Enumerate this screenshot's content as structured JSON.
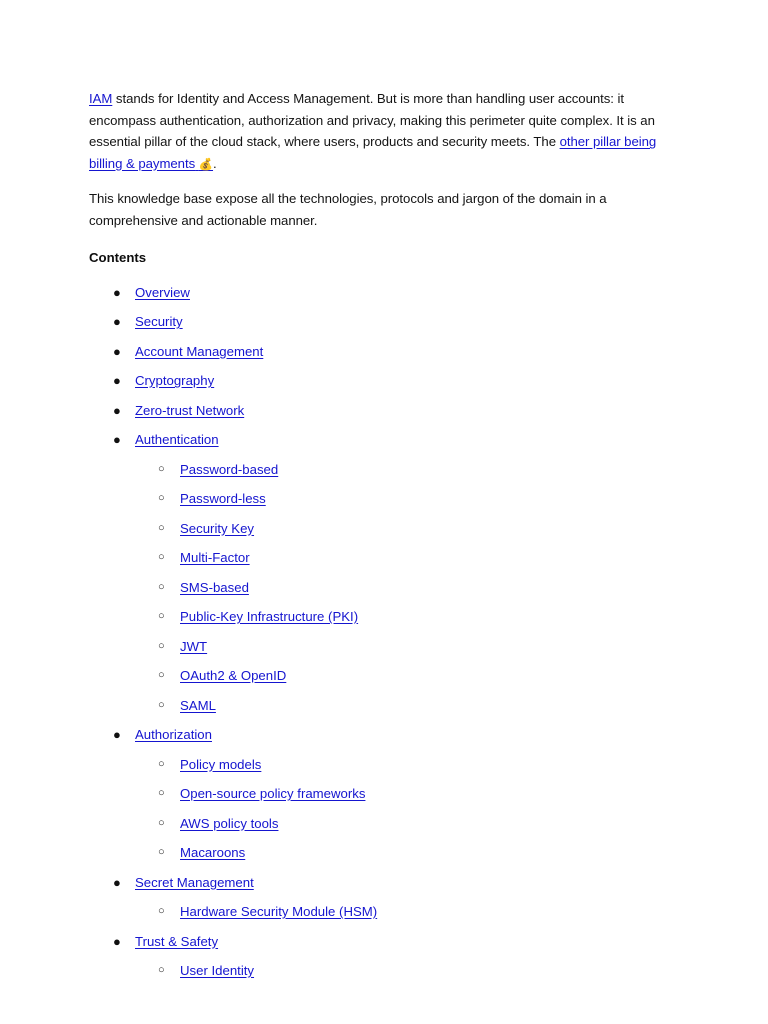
{
  "document": {
    "background_color": "#ffffff",
    "text_color": "#141414",
    "link_color": "#1515cf",
    "intro": {
      "link_label": "IAM",
      "body_part_1": " stands for Identity and Access Management. But is more than handling user accounts: it encompass authentication, authorization and privacy, making this perimeter quite complex. It is an essential pillar of the cloud stack, where users, products and security meets. The ",
      "secondary_link_label": "other pillar being billing & payments",
      "secondary_link_icon": "💰",
      "body_part_2": "."
    },
    "summary": "This knowledge base expose all the technologies, protocols and jargon of the domain in a comprehensive and actionable manner.",
    "contents_heading": "Contents",
    "toc": [
      {
        "label": "Overview",
        "level": 1
      },
      {
        "label": "Security",
        "level": 1
      },
      {
        "label": "Account Management",
        "level": 1
      },
      {
        "label": "Cryptography",
        "level": 1
      },
      {
        "label": "Zero-trust Network",
        "level": 1
      },
      {
        "label": "Authentication",
        "level": 1
      },
      {
        "label": "Password-based",
        "level": 2
      },
      {
        "label": "Password-less",
        "level": 2
      },
      {
        "label": "Security Key",
        "level": 2
      },
      {
        "label": "Multi-Factor",
        "level": 2
      },
      {
        "label": "SMS-based",
        "level": 2
      },
      {
        "label": "Public-Key Infrastructure (PKI)",
        "level": 2
      },
      {
        "label": "JWT",
        "level": 2
      },
      {
        "label": "OAuth2 & OpenID",
        "level": 2
      },
      {
        "label": "SAML",
        "level": 2
      },
      {
        "label": "Authorization",
        "level": 1
      },
      {
        "label": "Policy models",
        "level": 2
      },
      {
        "label": "Open-source policy frameworks",
        "level": 2
      },
      {
        "label": "AWS policy tools",
        "level": 2
      },
      {
        "label": "Macaroons",
        "level": 2
      },
      {
        "label": "Secret Management",
        "level": 1
      },
      {
        "label": "Hardware Security Module (HSM)",
        "level": 2
      },
      {
        "label": "Trust & Safety",
        "level": 1
      },
      {
        "label": "User Identity",
        "level": 2
      }
    ],
    "bullets": {
      "level_1_glyph": "●",
      "level_2_glyph": "○"
    }
  }
}
